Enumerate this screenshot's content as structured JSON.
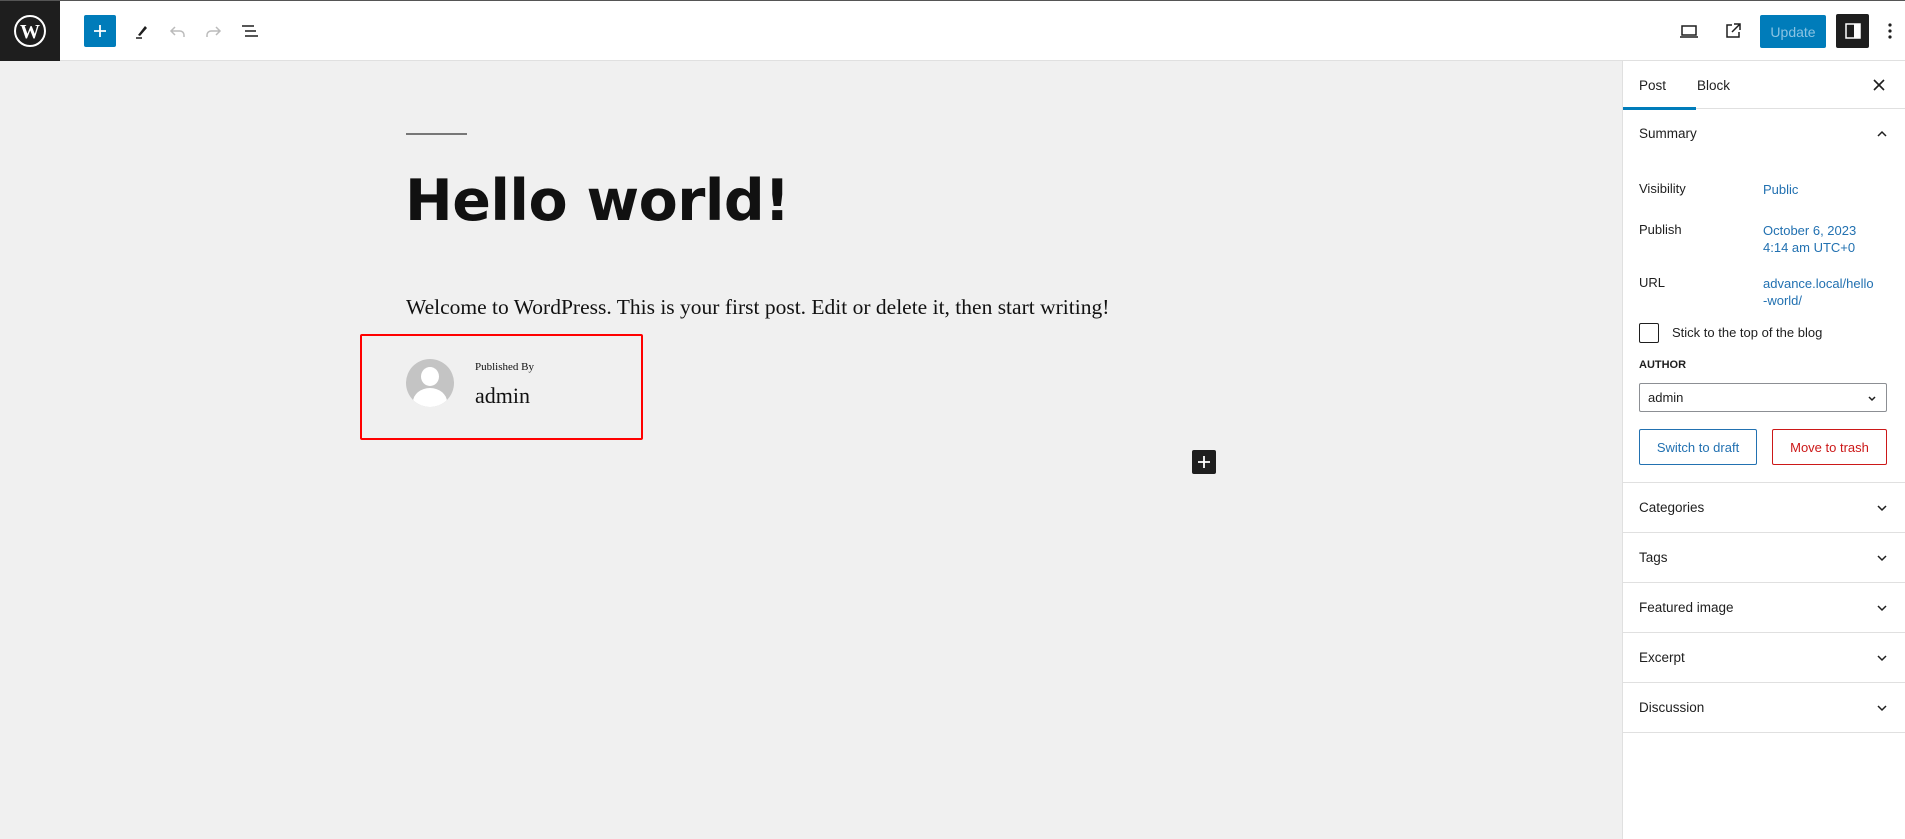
{
  "topbar": {
    "logo_icon": "wordpress-logo-icon",
    "add_block_icon": "plus-icon",
    "tools_icon": "pen-icon",
    "undo_icon": "undo-icon",
    "redo_icon": "redo-icon",
    "list_view_icon": "list-view-icon",
    "preview_icon": "desktop-preview-icon",
    "view_post_icon": "external-link-icon",
    "update_label": "Update",
    "settings_icon": "sidebar-toggle-icon",
    "options_icon": "more-vertical-icon"
  },
  "post": {
    "title": "Hello world!",
    "paragraph": "Welcome to WordPress. This is your first post. Edit or delete it, then start writing!",
    "author_box": {
      "published_by_label": "Published By",
      "author_name": "admin"
    }
  },
  "sidebar": {
    "tabs": [
      {
        "label": "Post",
        "active": true
      },
      {
        "label": "Block",
        "active": false
      }
    ],
    "close_icon": "close-icon",
    "summary": {
      "title": "Summary",
      "expanded": true,
      "rows": [
        {
          "label": "Visibility",
          "value": "Public"
        },
        {
          "label": "Publish",
          "value_line1": "October 6, 2023",
          "value_line2": "4:14 am UTC+0"
        },
        {
          "label": "URL",
          "value_line1": "advance.local/hello",
          "value_line2": "-world/"
        }
      ],
      "sticky_label": "Stick to the top of the blog",
      "sticky_checked": false,
      "author_label": "AUTHOR",
      "author_selected": "admin",
      "switch_to_draft_label": "Switch to draft",
      "move_to_trash_label": "Move to trash"
    },
    "sections": [
      {
        "title": "Categories"
      },
      {
        "title": "Tags"
      },
      {
        "title": "Featured image"
      },
      {
        "title": "Excerpt"
      },
      {
        "title": "Discussion"
      }
    ]
  },
  "colors": {
    "accent": "#007cba",
    "link": "#2271b1",
    "danger": "#cc1818",
    "highlight_box": "#ff0000",
    "canvas_bg": "#f0f0f0",
    "dark": "#1e1e1e"
  }
}
